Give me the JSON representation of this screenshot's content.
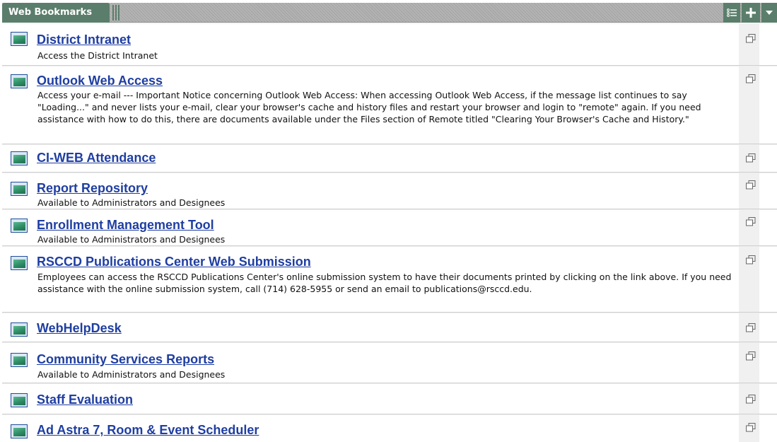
{
  "portlet": {
    "title": "Web Bookmarks",
    "accent_color": "#5a7e6b",
    "header_icons": [
      "list-icon",
      "plus-icon",
      "chevron-down-icon"
    ]
  },
  "bookmarks": [
    {
      "title": "District Intranet",
      "description": "Access the District Intranet"
    },
    {
      "title": "Outlook Web Access",
      "description": "Access your e-mail --- Important Notice concerning Outlook Web Access: When accessing Outlook Web Access, if the message list continues to say \"Loading...\" and never lists your e-mail, clear your browser's cache and history files and restart your browser and login to \"remote\" again. If you need assistance with how to do this, there are documents available under the Files section of Remote titled \"Clearing Your Browser's Cache and History.\""
    },
    {
      "title": "CI-WEB Attendance",
      "description": ""
    },
    {
      "title": "Report Repository",
      "description": "Available to Administrators and Designees"
    },
    {
      "title": "Enrollment Management Tool",
      "description": "Available to Administrators and Designees"
    },
    {
      "title": "RSCCD Publications Center Web Submission",
      "description": "Employees can access the RSCCD Publications Center's online submission system to have their documents printed by clicking on the link above. If you need assistance with the online submission system, call (714) 628-5955 or send an email to publications@rsccd.edu."
    },
    {
      "title": "WebHelpDesk",
      "description": ""
    },
    {
      "title": "Community Services Reports",
      "description": "Available to Administrators and Designees"
    },
    {
      "title": "Staff Evaluation",
      "description": ""
    },
    {
      "title": "Ad Astra 7, Room & Event Scheduler",
      "description": ""
    }
  ]
}
